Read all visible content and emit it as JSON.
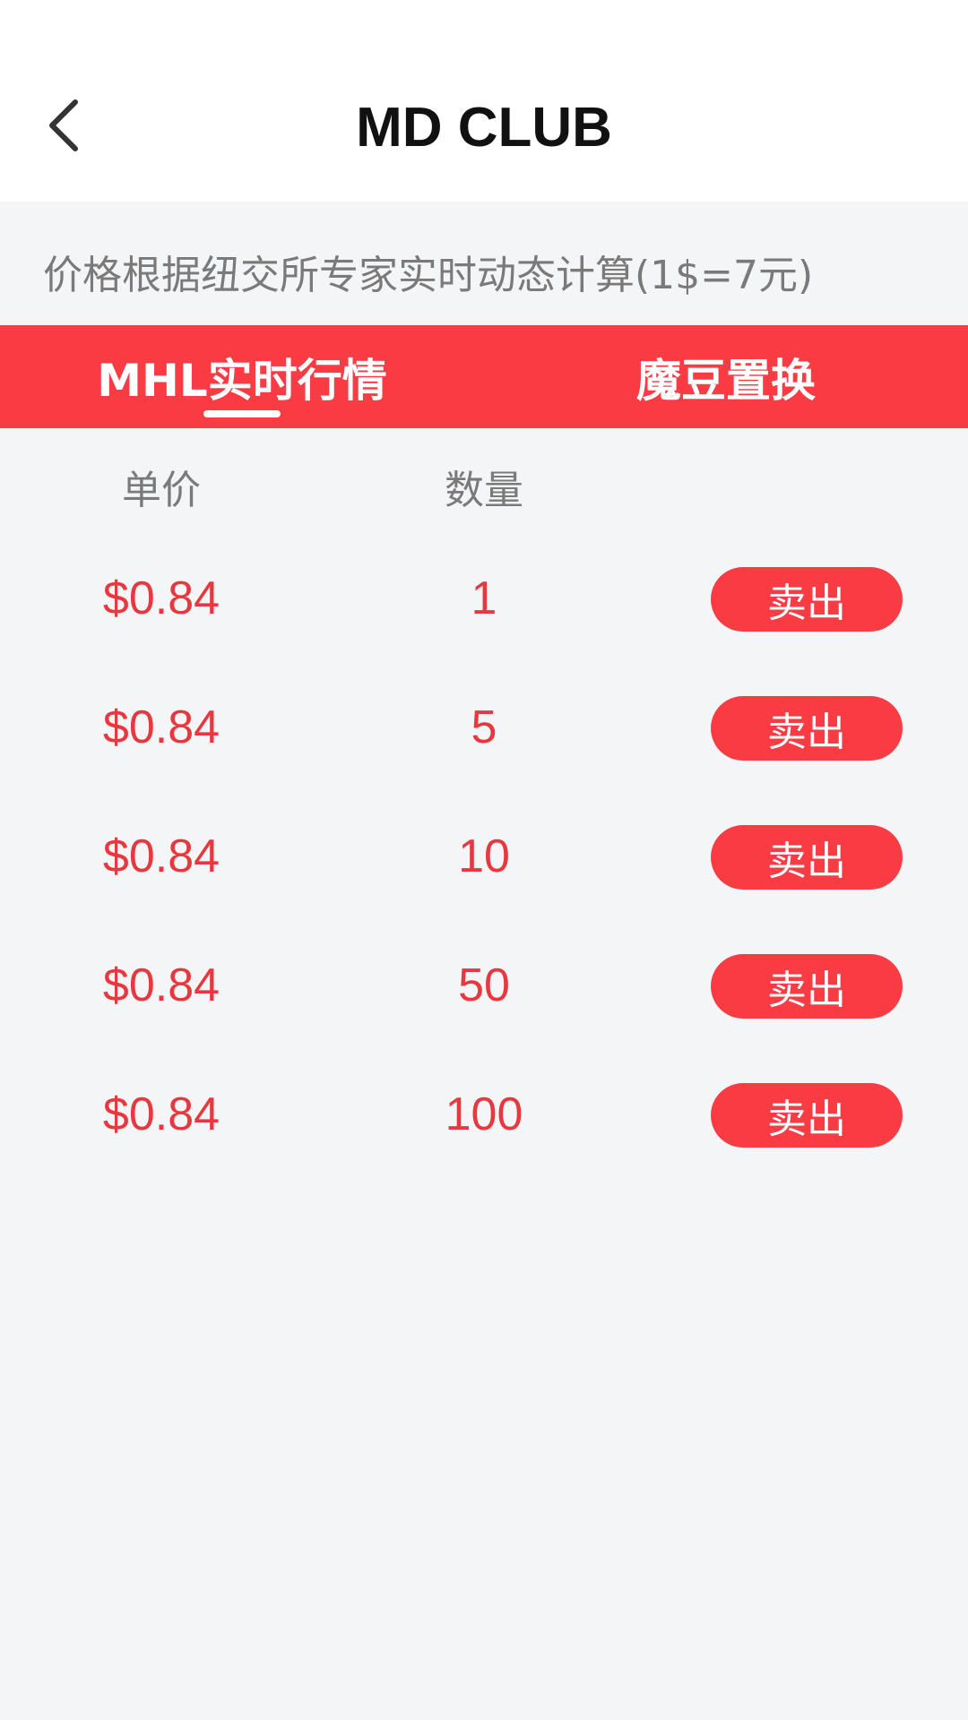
{
  "header": {
    "title": "MD CLUB",
    "back_icon": "chevron-left-icon"
  },
  "notice": "价格根据纽交所专家实时动态计算(1$=7元)",
  "tabs": [
    {
      "label": "MHL实时行情",
      "active": true
    },
    {
      "label": "魔豆置换",
      "active": false
    }
  ],
  "table": {
    "headers": {
      "price": "单价",
      "quantity": "数量"
    },
    "sell_label": "卖出",
    "rows": [
      {
        "price": "$0.84",
        "quantity": "1"
      },
      {
        "price": "$0.84",
        "quantity": "5"
      },
      {
        "price": "$0.84",
        "quantity": "10"
      },
      {
        "price": "$0.84",
        "quantity": "50"
      },
      {
        "price": "$0.84",
        "quantity": "100"
      }
    ]
  },
  "colors": {
    "accent": "#f93b44",
    "price_text": "#e8383f",
    "background": "#f4f5f7"
  }
}
